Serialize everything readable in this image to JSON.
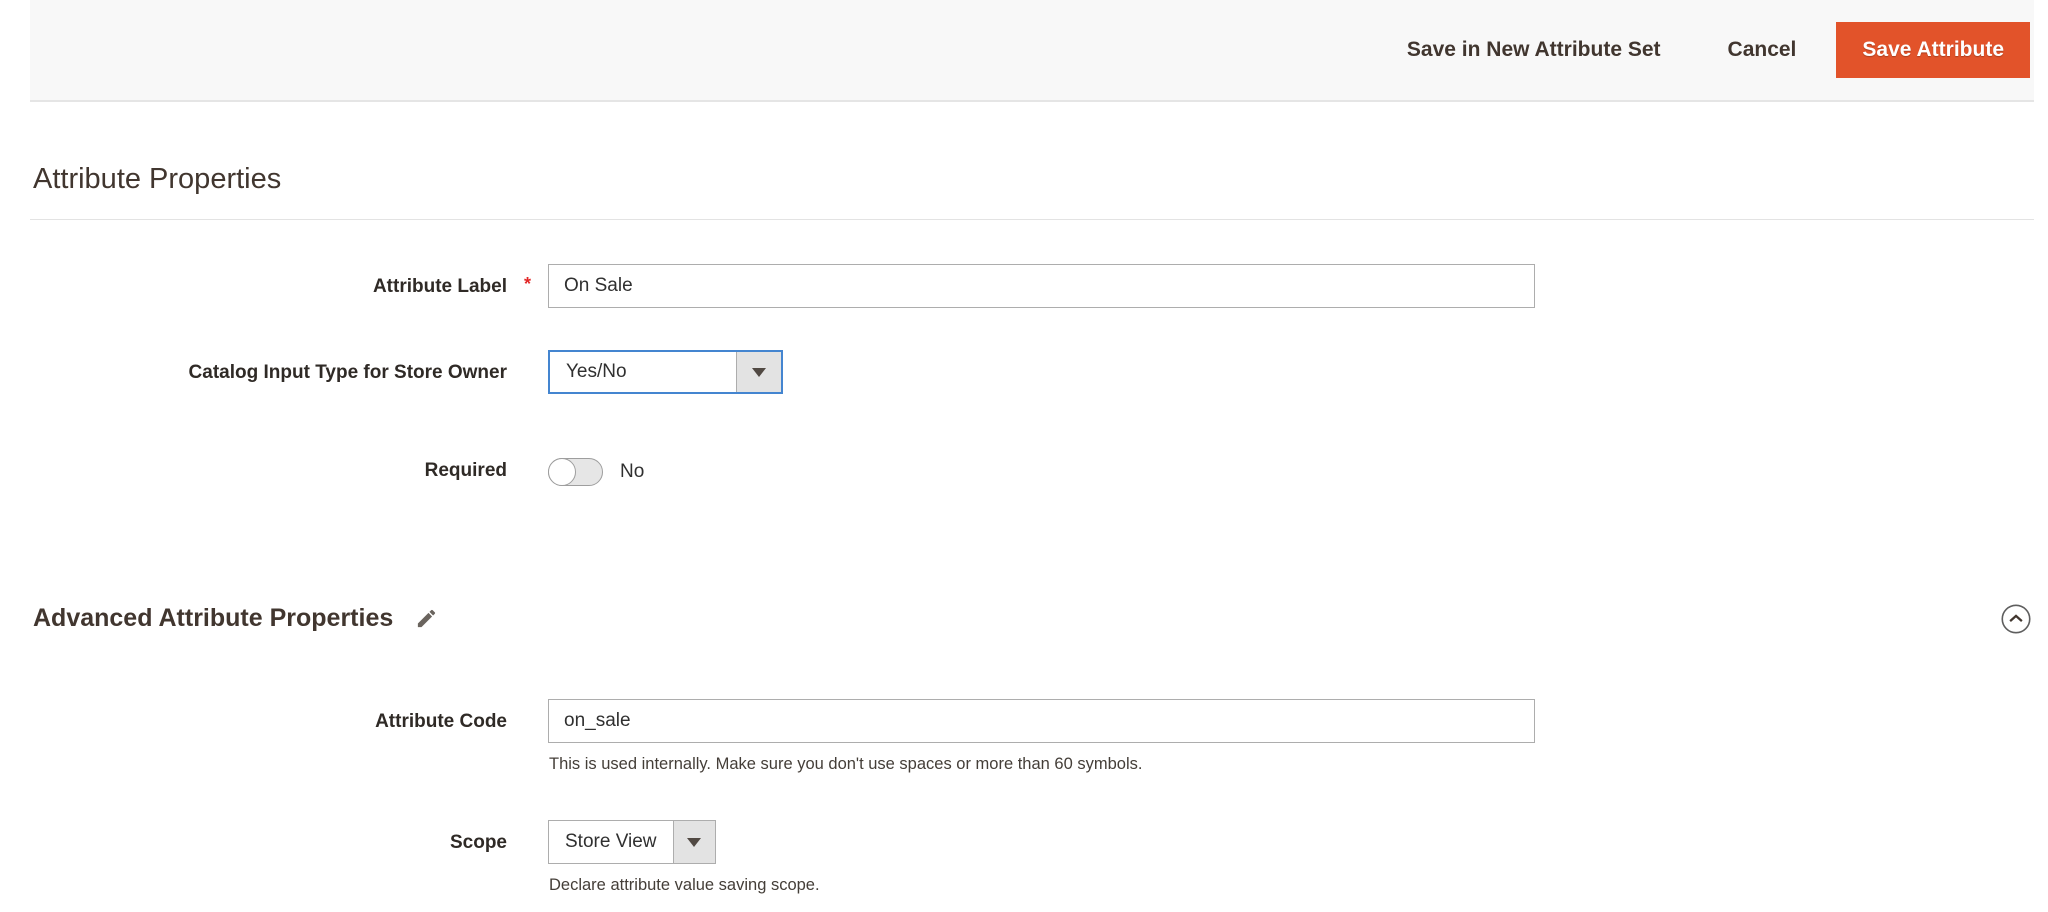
{
  "toolbar": {
    "save_in_new_attribute_set": "Save in New Attribute Set",
    "cancel": "Cancel",
    "save_attribute": "Save Attribute"
  },
  "colors": {
    "primary_button": "#e2532a",
    "focus_border": "#4485d0",
    "required_red": "#e22626"
  },
  "sections": [
    {
      "title": "Attribute Properties"
    },
    {
      "title": "Advanced Attribute Properties"
    }
  ],
  "fields": {
    "attribute_label": {
      "label": "Attribute Label",
      "required_mark": "*",
      "value": "On Sale"
    },
    "catalog_input_type": {
      "label": "Catalog Input Type for Store Owner",
      "value": "Yes/No"
    },
    "required": {
      "label": "Required",
      "value": "No"
    },
    "attribute_code": {
      "label": "Attribute Code",
      "value": "on_sale",
      "note": "This is used internally. Make sure you don't use spaces or more than 60 symbols."
    },
    "scope": {
      "label": "Scope",
      "value": "Store View",
      "note": "Declare attribute value saving scope."
    }
  },
  "icons": {
    "edit_pencil": "edit-pencil-icon",
    "collapse_chevron": "collapse-chevron-up-icon",
    "dropdown_caret": "dropdown-caret-icon"
  }
}
